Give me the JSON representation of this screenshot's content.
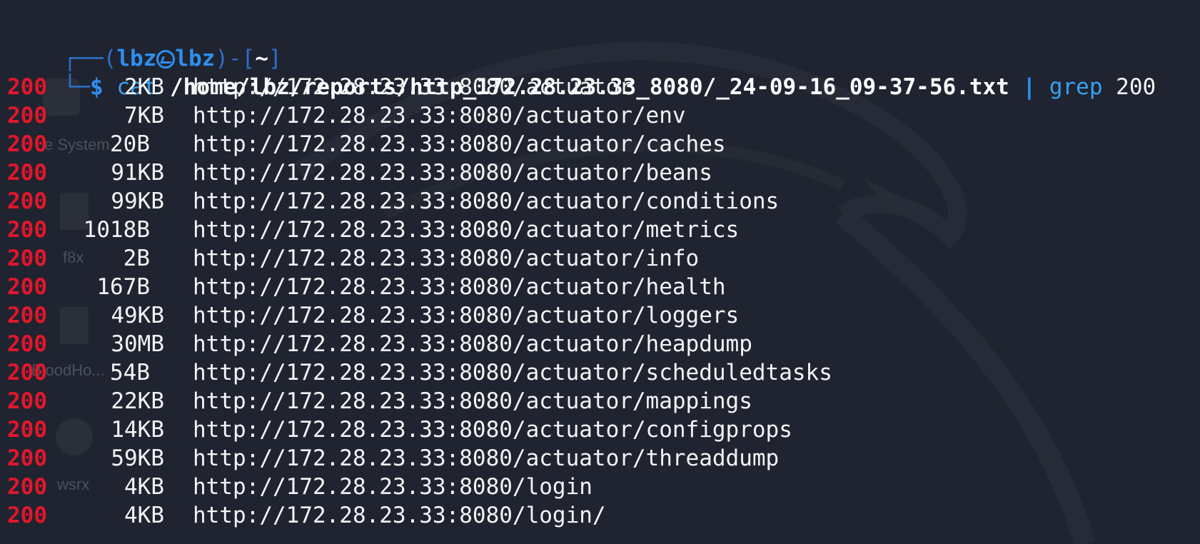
{
  "prompt": {
    "corner": "┌──(",
    "user": "lbz",
    "host": "lbz",
    "close": ")-[",
    "dir": "~",
    "end": "]",
    "arrow": "└─",
    "dollar": "$",
    "cmd": "cat",
    "path": "/home/lbz/reports/http_172.28.23.33_8080/_24-09-16_09-37-56.txt",
    "pipe": "|",
    "grep": "grep",
    "arg": "200"
  },
  "desktop_labels": [
    "e System",
    "f8x",
    "BloodHo...",
    "wsrx"
  ],
  "rows": [
    {
      "status": "200",
      "size": "2KB",
      "url": "http://172.28.23.33:8080/actuator"
    },
    {
      "status": "200",
      "size": "7KB",
      "url": "http://172.28.23.33:8080/actuator/env"
    },
    {
      "status": "200",
      "size": "20B",
      "url": "http://172.28.23.33:8080/actuator/caches"
    },
    {
      "status": "200",
      "size": "91KB",
      "url": "http://172.28.23.33:8080/actuator/beans"
    },
    {
      "status": "200",
      "size": "99KB",
      "url": "http://172.28.23.33:8080/actuator/conditions"
    },
    {
      "status": "200",
      "size": "1018B",
      "url": "http://172.28.23.33:8080/actuator/metrics"
    },
    {
      "status": "200",
      "size": "2B",
      "url": "http://172.28.23.33:8080/actuator/info"
    },
    {
      "status": "200",
      "size": "167B",
      "url": "http://172.28.23.33:8080/actuator/health"
    },
    {
      "status": "200",
      "size": "49KB",
      "url": "http://172.28.23.33:8080/actuator/loggers"
    },
    {
      "status": "200",
      "size": "30MB",
      "url": "http://172.28.23.33:8080/actuator/heapdump"
    },
    {
      "status": "200",
      "size": "54B",
      "url": "http://172.28.23.33:8080/actuator/scheduledtasks"
    },
    {
      "status": "200",
      "size": "22KB",
      "url": "http://172.28.23.33:8080/actuator/mappings"
    },
    {
      "status": "200",
      "size": "14KB",
      "url": "http://172.28.23.33:8080/actuator/configprops"
    },
    {
      "status": "200",
      "size": "59KB",
      "url": "http://172.28.23.33:8080/actuator/threaddump"
    },
    {
      "status": "200",
      "size": "4KB",
      "url": "http://172.28.23.33:8080/login"
    },
    {
      "status": "200",
      "size": "4KB",
      "url": "http://172.28.23.33:8080/login/"
    }
  ]
}
